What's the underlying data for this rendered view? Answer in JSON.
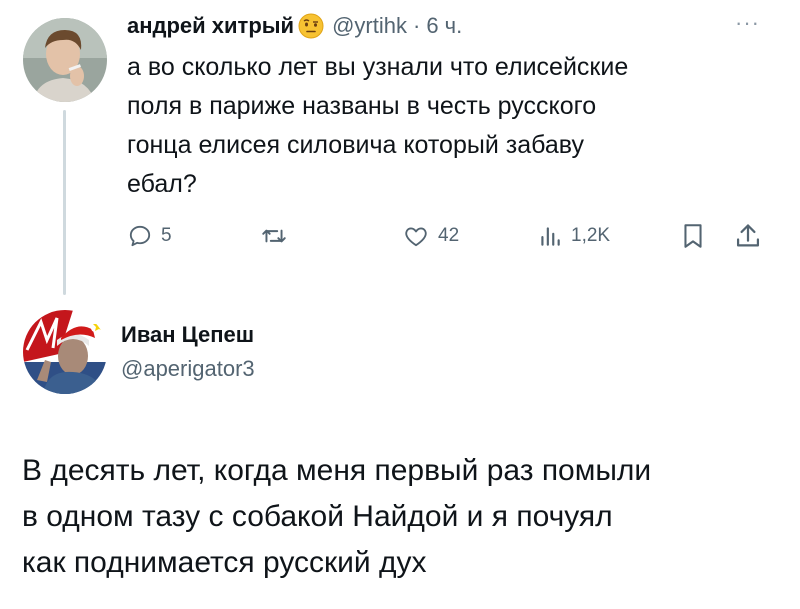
{
  "tweet1": {
    "author_name": "андрей хитрый",
    "author_emoji": "face-with-raised-eyebrow-icon",
    "handle": "@yrtihk",
    "separator": "·",
    "time": "6 ч.",
    "more_label": "···",
    "text": "а во сколько лет вы узнали что елисейские\nполя в париже названы в честь русского\nгонца елисея силовича который забаву\nебал?",
    "actions": {
      "reply_count": "5",
      "retweet_count": "",
      "like_count": "42",
      "views_count": "1,2K"
    }
  },
  "tweet2": {
    "author_name": "Иван Цепеш",
    "handle": "@aperigator3",
    "text": "В десять лет, когда меня первый раз помыли\nв одном тазу с собакой Найдой и я почуял\nкак поднимается русский дух"
  },
  "colors": {
    "text_primary": "#0f1419",
    "text_secondary": "#536471",
    "thread_line": "#cfd9de"
  }
}
